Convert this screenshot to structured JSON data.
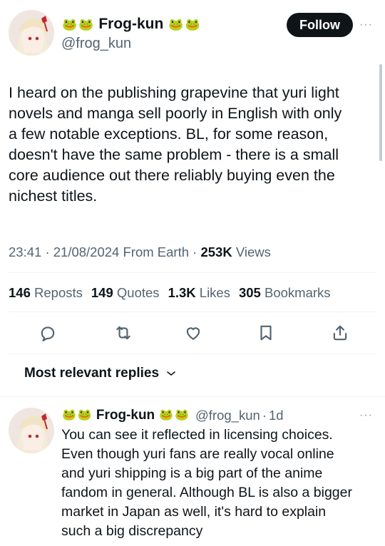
{
  "tweet": {
    "author_name": "Frog-kun",
    "name_emoji": "🐸",
    "handle": "@frog_kun",
    "follow_label": "Follow",
    "more_label": "···",
    "text": "I heard on the publishing grapevine that yuri light\nnovels and manga sell poorly in English with only\na few notable exceptions. BL, for some reason,\ndoesn't have the same problem - there is a small\ncore audience out there reliably buying even the\nnichest titles.",
    "time": "23:41",
    "date": "21/08/2024",
    "location": "From Earth",
    "views_count": "253K",
    "views_label": "Views",
    "sep": "·"
  },
  "stats": {
    "reposts_count": "146",
    "reposts_label": "Reposts",
    "quotes_count": "149",
    "quotes_label": "Quotes",
    "likes_count": "1.3K",
    "likes_label": "Likes",
    "bookmarks_count": "305",
    "bookmarks_label": "Bookmarks"
  },
  "actions": [
    "reply-icon",
    "repost-icon",
    "like-icon",
    "bookmark-icon",
    "share-icon"
  ],
  "replies_header": {
    "label": "Most relevant replies",
    "chevron": "⌄"
  },
  "reply": {
    "author_name": "Frog-kun",
    "handle": "@frog_kun",
    "age": "1d",
    "sep": "·",
    "more_label": "···",
    "text": "You can see it reflected in licensing choices.\nEven though yuri fans are really vocal online\nand yuri shipping is a big part of the anime\nfandom in general. Although BL is also a bigger\nmarket in Japan as well, it's hard to explain\nsuch a big discrepancy"
  },
  "colors": {
    "text": "#0f1419",
    "secondary": "#536471",
    "divider": "#eff3f4",
    "button": "#0f1419"
  }
}
